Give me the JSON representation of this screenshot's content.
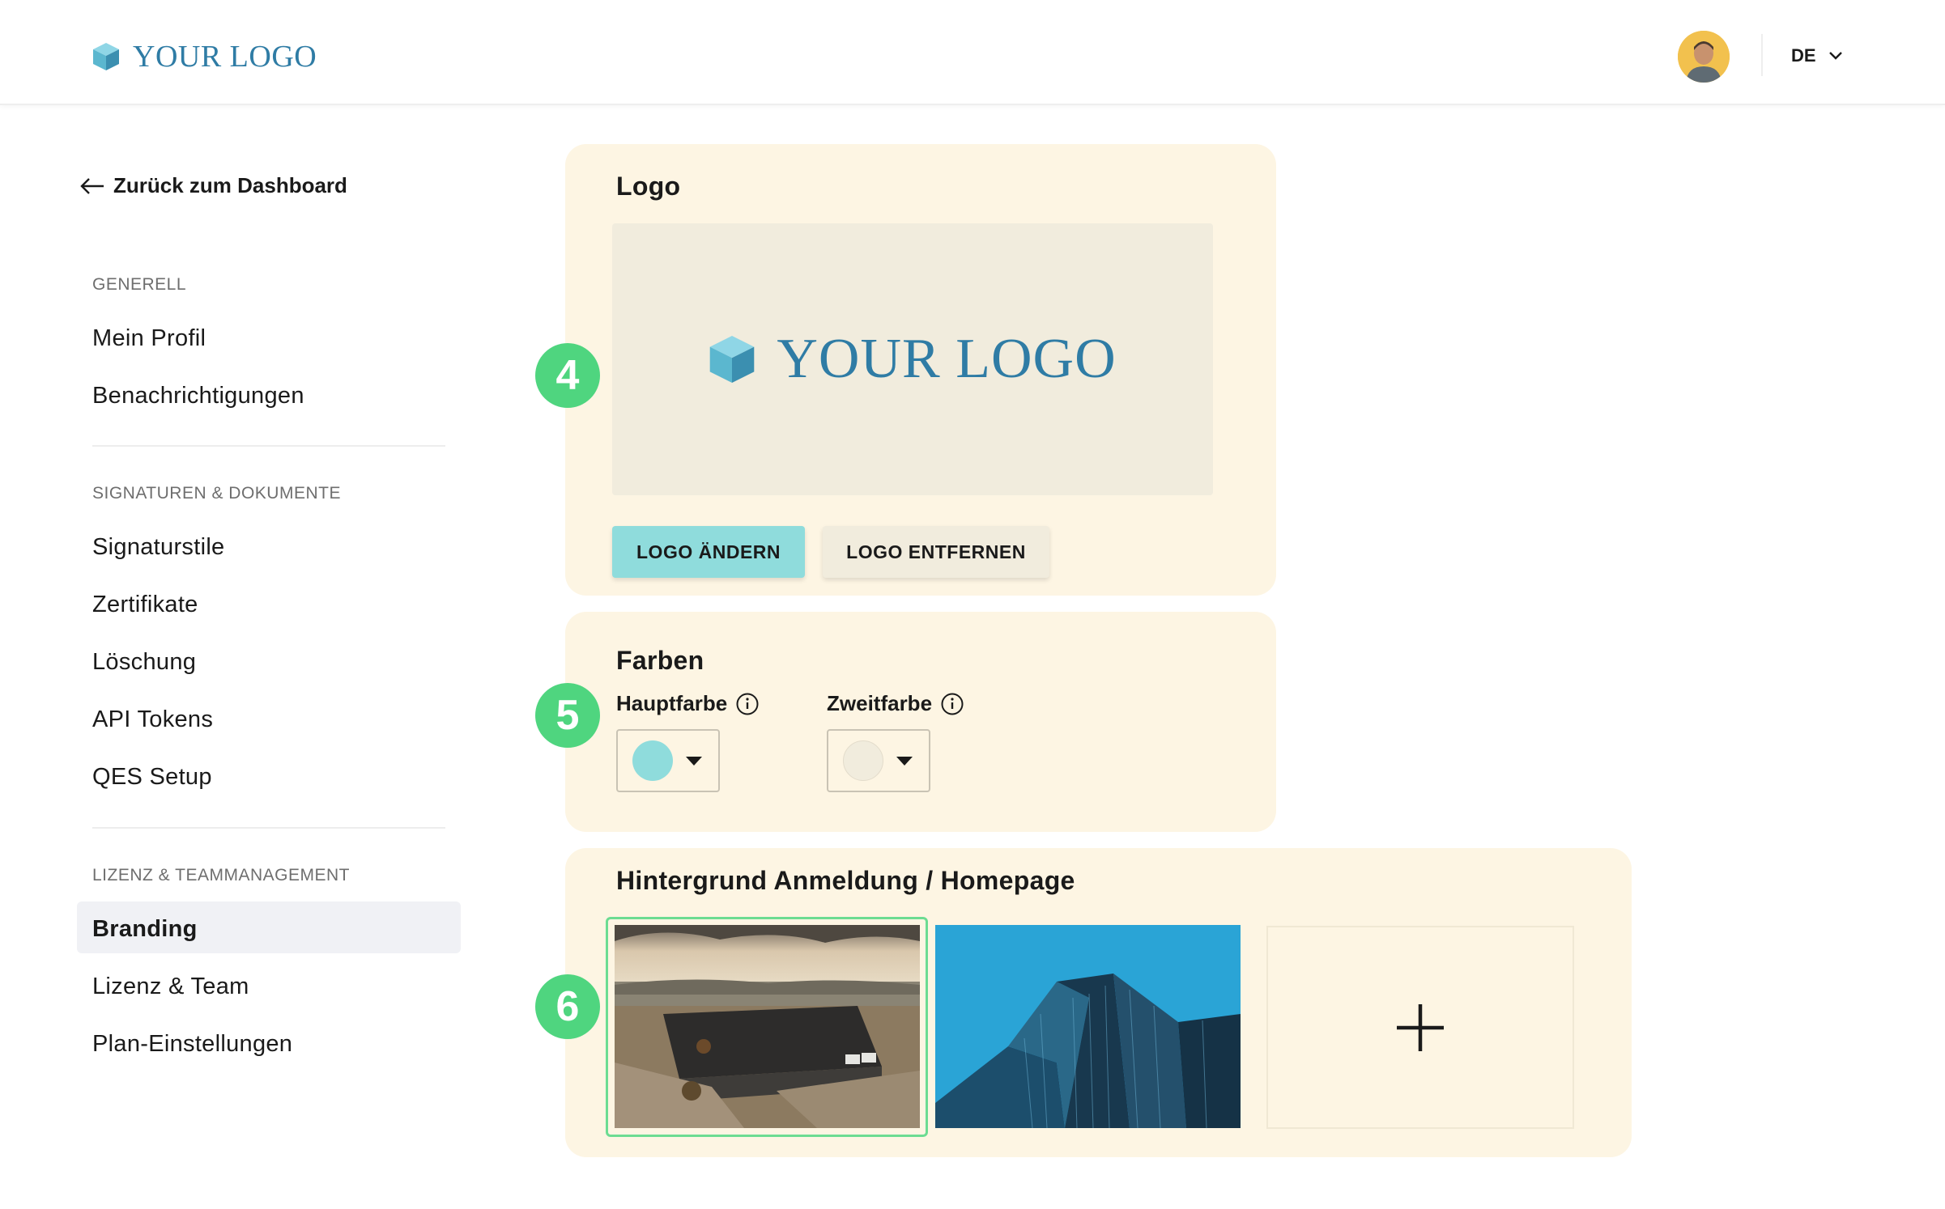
{
  "header": {
    "logo_icon": "cube-icon",
    "logo_text": "YOUR LOGO",
    "avatar_alt": "User avatar",
    "language": "DE",
    "language_icon": "chevron-down-icon"
  },
  "sidebar": {
    "back_label": "Zurück zum Dashboard",
    "back_icon": "arrow-left-icon",
    "sections": [
      {
        "label": "GENERELL",
        "items": [
          "Mein Profil",
          "Benachrichtigungen"
        ]
      },
      {
        "label": "SIGNATUREN & DOKUMENTE",
        "items": [
          "Signaturstile",
          "Zertifikate",
          "Löschung",
          "API Tokens",
          "QES Setup"
        ]
      },
      {
        "label": "LIZENZ & TEAMMANAGEMENT",
        "items": [
          "Branding",
          "Lizenz & Team",
          "Plan-Einstellungen"
        ]
      }
    ],
    "active_item": "Branding"
  },
  "logo_card": {
    "title": "Logo",
    "preview_text": "YOUR LOGO",
    "change_button": "LOGO ÄNDERN",
    "remove_button": "LOGO ENTFERNEN",
    "badge": "4"
  },
  "colors_card": {
    "title": "Farben",
    "primary_label": "Hauptfarbe",
    "secondary_label": "Zweitfarbe",
    "primary_color": "#8fdcdc",
    "secondary_color": "#f1ecdd",
    "info_icon": "info-icon",
    "badge": "5"
  },
  "background_card": {
    "title": "Hintergrund Anmeldung / Homepage",
    "images": [
      "factory-aerial-image",
      "skyscraper-image"
    ],
    "selected_index": 0,
    "add_icon": "plus-icon",
    "badge": "6"
  },
  "colors": {
    "accent": "#8fdcdc",
    "card_bg": "#fdf5e3",
    "badge": "#4fd57f",
    "logo_text": "#2f7ca5"
  }
}
